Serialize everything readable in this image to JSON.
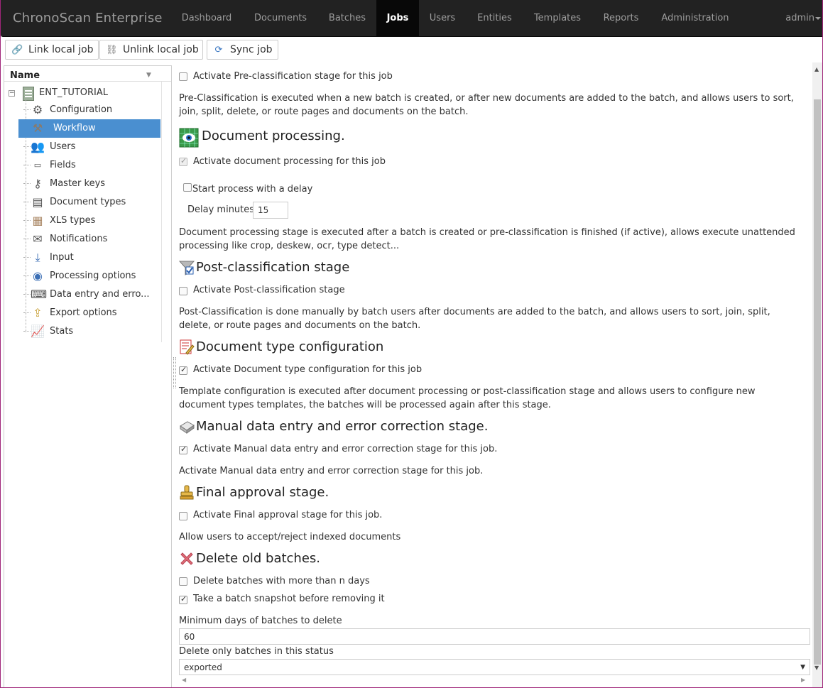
{
  "app_title": "ChronoScan Enterprise",
  "nav": {
    "items": [
      "Dashboard",
      "Documents",
      "Batches",
      "Jobs",
      "Users",
      "Entities",
      "Templates",
      "Reports",
      "Administration"
    ],
    "active": "Jobs",
    "user": "admin"
  },
  "toolbar": {
    "link": "Link local job",
    "unlink": "Unlink local job",
    "sync": "Sync job"
  },
  "tree": {
    "header": "Name",
    "root": "ENT_TUTORIAL",
    "items": [
      "Configuration",
      "Workflow",
      "Users",
      "Fields",
      "Master keys",
      "Document types",
      "XLS types",
      "Notifications",
      "Input",
      "Processing options",
      "Data entry and erro...",
      "Export options",
      "Stats"
    ],
    "selected": "Workflow"
  },
  "workflow": {
    "preclass": {
      "checkbox": "Activate Pre-classification stage for this job",
      "checked": false,
      "desc": "Pre-Classification is executed when a new batch is created, or after new documents are added to the batch, and allows users to sort, join, split, delete, or route pages and documents on the batch."
    },
    "docproc": {
      "title": "Document processing.",
      "checkbox": "Activate document processing for this job",
      "checked": true,
      "delay_checkbox": "Start process with a delay",
      "delay_checked": false,
      "delay_label": "Delay minutes",
      "delay_value": "15",
      "desc": "Document processing stage is executed after a batch is created or pre-classification is finished (if active), allows execute unattended processing like crop, deskew, ocr, type detect..."
    },
    "postclass": {
      "title": "Post-classification stage",
      "checkbox": "Activate Post-classification stage",
      "checked": false,
      "desc": "Post-Classification is done manually by batch users after documents are added to the batch, and allows users to sort, join, split, delete, or route pages and documents on the batch."
    },
    "doctype": {
      "title": "Document type configuration",
      "checkbox": "Activate Document type configuration for this job",
      "checked": true,
      "desc": "Template configuration is executed after document processing or post-classification stage and allows users to configure new document types templates, the batches will be processed again after this stage."
    },
    "manual": {
      "title": "Manual data entry and error correction stage.",
      "checkbox": "Activate Manual data entry and error correction stage for this job.",
      "checked": true,
      "desc": "Activate Manual data entry and error correction stage for this job."
    },
    "approval": {
      "title": "Final approval stage.",
      "checkbox": "Activate Final approval stage for this job.",
      "checked": false,
      "desc": "Allow users to accept/reject indexed documents"
    },
    "delete": {
      "title": "Delete old batches.",
      "checkbox1": "Delete batches with more than n days",
      "checked1": false,
      "checkbox2": "Take a batch snapshot before removing it",
      "checked2": true,
      "min_days_label": "Minimum days of batches to delete",
      "min_days_value": "60",
      "status_label": "Delete only batches in this status",
      "status_value": "exported"
    }
  },
  "colors": {
    "navbar": "#222222",
    "accent_selected": "#4a8fd0",
    "frame": "#a0267a"
  }
}
